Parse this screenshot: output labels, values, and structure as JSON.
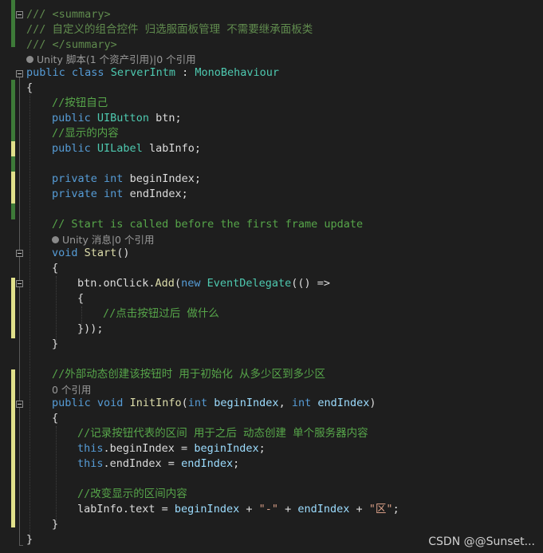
{
  "code": {
    "l1": "/// <summary>",
    "l2": "/// 自定义的组合控件 归选服面板管理 不需要继承面板类",
    "l3": "/// </summary>",
    "l4_lens": "Unity 脚本(1 个资产引用)|0 个引用",
    "l5_kw1": "public",
    "l5_kw2": "class",
    "l5_name": "ServerIntm",
    "l5_sep": " : ",
    "l5_base": "MonoBehaviour",
    "l6": "{",
    "l7": "//按钮自己",
    "l8_kw": "public",
    "l8_type": "UIButton",
    "l8_rest": " btn;",
    "l9": "//显示的内容",
    "l10_kw": "public",
    "l10_type": "UILabel",
    "l10_rest": " labInfo;",
    "l12_kw": "private",
    "l12_type": "int",
    "l12_rest": " beginIndex;",
    "l13_kw": "private",
    "l13_type": "int",
    "l13_rest": " endIndex;",
    "l15": "// Start is called before the first frame update",
    "l16_lens": "Unity 消息|0 个引用",
    "l17_kw": "void",
    "l17_fn": "Start",
    "l17_rest": "()",
    "l18": "{",
    "l19_a": "btn.onClick.",
    "l19_fn": "Add",
    "l19_b": "(",
    "l19_kw": "new",
    "l19_type": "EventDelegate",
    "l19_c": "(() =>",
    "l20": "{",
    "l21": "//点击按钮过后 做什么",
    "l22": "}));",
    "l23": "}",
    "l25": "//外部动态创建该按钮时 用于初始化 从多少区到多少区",
    "l26_lens": "0 个引用",
    "l27_kw1": "public",
    "l27_kw2": "void",
    "l27_fn": "InitInfo",
    "l27_a": "(",
    "l27_t1": "int",
    "l27_p1": "beginIndex",
    "l27_b": ", ",
    "l27_t2": "int",
    "l27_p2": "endIndex",
    "l27_c": ")",
    "l28": "{",
    "l29": "//记录按钮代表的区间 用于之后 动态创建 单个服务器内容",
    "l30_kw": "this",
    "l30_a": ".beginIndex = ",
    "l30_p": "beginIndex",
    "l30_b": ";",
    "l31_kw": "this",
    "l31_a": ".endIndex = ",
    "l31_p": "endIndex",
    "l31_b": ";",
    "l33": "//改变显示的区间内容",
    "l34_a": "labInfo.text = ",
    "l34_p1": "beginIndex",
    "l34_b": " + ",
    "l34_s1": "\"-\"",
    "l34_c": " + ",
    "l34_p2": "endIndex",
    "l34_d": " + ",
    "l34_s2": "\"区\"",
    "l34_e": ";",
    "l35": "}",
    "l36": "}"
  },
  "watermark": "CSDN @@Sunset...",
  "colors": {
    "background": "#1e1e1e",
    "keyword": "#569cd6",
    "type": "#4ec9b0",
    "comment": "#57a64a",
    "string": "#d69d85"
  }
}
